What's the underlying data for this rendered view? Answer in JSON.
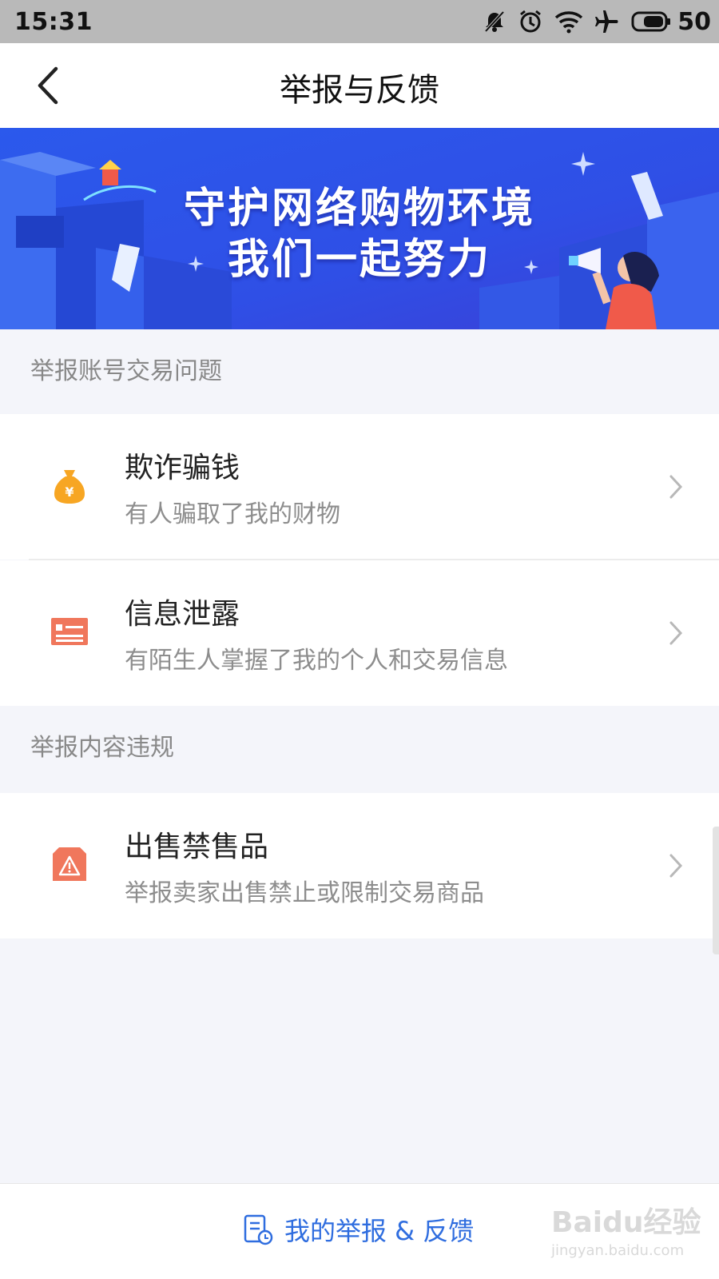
{
  "status_bar": {
    "time": "15:31",
    "battery": "50"
  },
  "nav": {
    "title": "举报与反馈"
  },
  "banner": {
    "line1": "守护网络购物环境",
    "line2": "我们一起努力"
  },
  "sections": [
    {
      "title": "举报账号交易问题",
      "items": [
        {
          "title": "欺诈骗钱",
          "subtitle": "有人骗取了我的财物",
          "icon": "money-bag-icon"
        },
        {
          "title": "信息泄露",
          "subtitle": "有陌生人掌握了我的个人和交易信息",
          "icon": "id-card-icon"
        }
      ]
    },
    {
      "title": "举报内容违规",
      "items": [
        {
          "title": "出售禁售品",
          "subtitle": "举报卖家出售禁止或限制交易商品",
          "icon": "warning-box-icon"
        }
      ]
    }
  ],
  "bottom": {
    "link": "我的举报 & 反馈"
  },
  "watermark": {
    "top": "Baidu经验",
    "bottom": "jingyan.baidu.com"
  },
  "colors": {
    "accent": "#2f6ddf",
    "banner": "#2f55e8",
    "orange": "#f7a623",
    "coral": "#f0775c"
  }
}
